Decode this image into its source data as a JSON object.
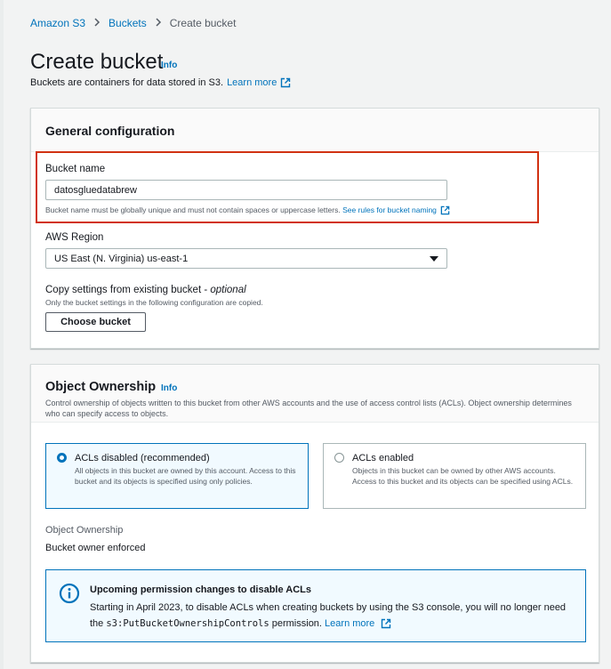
{
  "breadcrumb": {
    "items": [
      "Amazon S3",
      "Buckets",
      "Create bucket"
    ],
    "separator": ">"
  },
  "page": {
    "title": "Create bucket",
    "info": "Info",
    "description": "Buckets are containers for data stored in S3.",
    "learn_more": "Learn more"
  },
  "general": {
    "title": "General configuration",
    "bucket_name_label": "Bucket name",
    "bucket_name_value": "datosgluedatabrew",
    "bucket_name_hint": "Bucket name must be globally unique and must not contain spaces or uppercase letters.",
    "bucket_rules_link": "See rules for bucket naming",
    "region_label": "AWS Region",
    "region_value": "US East (N. Virginia) us-east-1",
    "copy_label": "Copy settings from existing bucket - ",
    "copy_optional": "optional",
    "copy_hint": "Only the bucket settings in the following configuration are copied.",
    "choose_button": "Choose bucket"
  },
  "ownership": {
    "title": "Object Ownership",
    "info": "Info",
    "description": "Control ownership of objects written to this bucket from other AWS accounts and the use of access control lists (ACLs). Object ownership determines who can specify access to objects.",
    "options": [
      {
        "title": "ACLs disabled (recommended)",
        "description": "All objects in this bucket are owned by this account. Access to this bucket and its objects is specified using only policies.",
        "selected": true
      },
      {
        "title": "ACLs enabled",
        "description": "Objects in this bucket can be owned by other AWS accounts. Access to this bucket and its objects can be specified using ACLs.",
        "selected": false
      }
    ],
    "owner_label": "Object Ownership",
    "owner_value": "Bucket owner enforced",
    "alert": {
      "title": "Upcoming permission changes to disable ACLs",
      "body_prefix": "Starting in April 2023, to disable ACLs when creating buckets by using the S3 console, you will no longer need the ",
      "code": "s3:PutBucketOwnershipControls",
      "body_suffix": " permission.",
      "learn_more": "Learn more"
    }
  },
  "colors": {
    "accent": "#0073bb",
    "highlight": "#d13212",
    "background": "#f2f3f3"
  },
  "icons": [
    "chevron-right-icon",
    "external-link-icon",
    "caret-down-icon",
    "info-circle-icon"
  ]
}
